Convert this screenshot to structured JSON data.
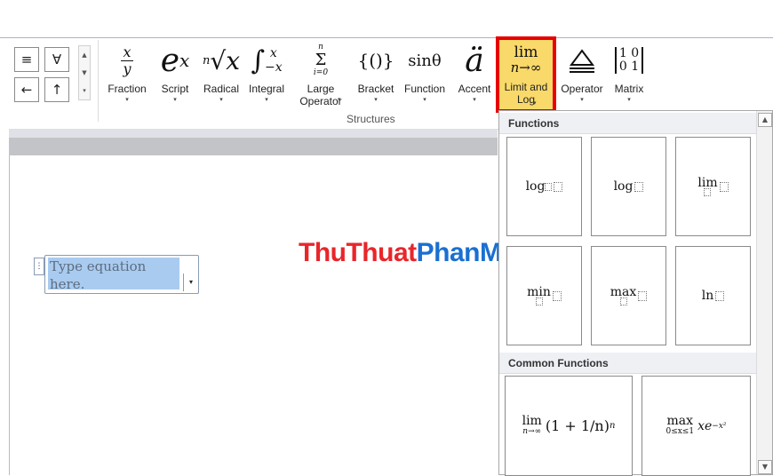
{
  "symbols": {
    "row1": [
      "≡",
      "∀"
    ],
    "row2": [
      "←",
      "↑"
    ],
    "scroll": [
      "▲",
      "▼",
      "▾"
    ]
  },
  "structures": {
    "group_label": "Structures",
    "buttons": [
      {
        "id": "fraction",
        "icon": "fraction-icon",
        "label": "Fraction",
        "caret": "▾"
      },
      {
        "id": "script",
        "icon": "script-icon",
        "label": "Script",
        "caret": "▾"
      },
      {
        "id": "radical",
        "icon": "radical-icon",
        "label": "Radical",
        "caret": "▾"
      },
      {
        "id": "integral",
        "icon": "integral-icon",
        "label": "Integral",
        "caret": "▾"
      },
      {
        "id": "large-operator",
        "icon": "large-operator-icon",
        "label": "Large Operator",
        "caret": "▾"
      },
      {
        "id": "bracket",
        "icon": "bracket-icon",
        "label": "Bracket",
        "caret": "▾"
      },
      {
        "id": "function",
        "icon": "function-icon",
        "label": "Function",
        "caret": "▾"
      },
      {
        "id": "accent",
        "icon": "accent-icon",
        "label": "Accent",
        "caret": "▾"
      },
      {
        "id": "limit-and-log",
        "icon": "limit-icon",
        "label": "Limit and Log",
        "caret": "▾"
      },
      {
        "id": "operator",
        "icon": "operator-icon",
        "label": "Operator",
        "caret": "▾"
      },
      {
        "id": "matrix",
        "icon": "matrix-icon",
        "label": "Matrix",
        "caret": "▾"
      }
    ],
    "icon_text": {
      "fraction_num": "x",
      "fraction_den": "y",
      "script_base": "e",
      "script_sup": "x",
      "radical_index": "n",
      "radical_body": "√x",
      "integral_sign": "∫",
      "integral_upper": "x",
      "integral_lower": "−x",
      "largeop_upper": "n",
      "largeop_sign": "Σ",
      "largeop_lower": "i=0",
      "bracket": "{()}",
      "function": "sinθ",
      "accent": "ä",
      "limit_top": "lim",
      "limit_bottom": "n→∞",
      "matrix_row1": "1 0",
      "matrix_row2": "0 1"
    }
  },
  "equation": {
    "placeholder": "Type equation here.",
    "handle": "⋮",
    "dropdown": "▾"
  },
  "watermark": {
    "part1": "ThuThuat",
    "part2": "PhanMem.vn"
  },
  "dropdown": {
    "functions_header": "Functions",
    "functions": [
      {
        "name": "log",
        "sub": true
      },
      {
        "name": "log",
        "sub": false
      },
      {
        "name": "lim",
        "under": true
      },
      {
        "name": "min",
        "under": true
      },
      {
        "name": "max",
        "under": true
      },
      {
        "name": "ln",
        "sub": false
      }
    ],
    "common_header": "Common Functions",
    "common": [
      {
        "op": "lim",
        "under": "n→∞",
        "body": "(1 + 1/n)",
        "sup": "n"
      },
      {
        "op": "max",
        "under": "0≤x≤1",
        "body": "xe",
        "sup": "−x²"
      }
    ],
    "scroll_up": "▲",
    "scroll_down": "▼"
  },
  "colors": {
    "highlight_fill": "#f9d96a",
    "highlight_border": "#e80000",
    "watermark_red": "#e8262a",
    "watermark_blue": "#1a6fd1"
  }
}
